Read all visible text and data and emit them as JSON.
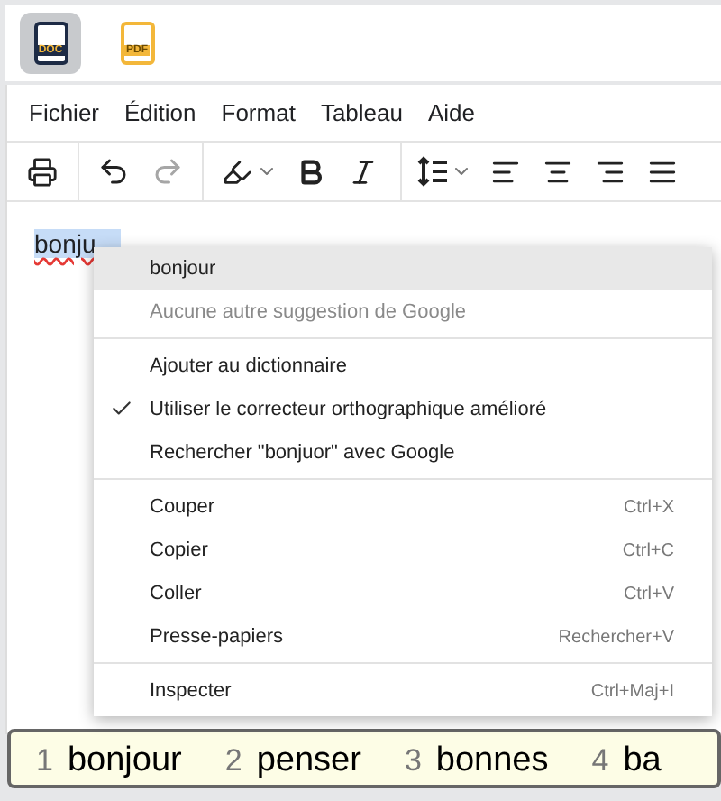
{
  "file_types": [
    {
      "label": "DOC",
      "selected": true
    },
    {
      "label": "PDF",
      "selected": false
    }
  ],
  "menu_bar": [
    "Fichier",
    "Édition",
    "Format",
    "Tableau",
    "Aide"
  ],
  "toolbar": {
    "redo_disabled": true
  },
  "document": {
    "text": "bonju"
  },
  "context_menu": {
    "sections": [
      [
        {
          "label": "bonjour",
          "selected": true,
          "disabled": false,
          "checked": false
        },
        {
          "label": "Aucune autre suggestion de Google",
          "selected": false,
          "disabled": true,
          "checked": false
        }
      ],
      [
        {
          "label": "Ajouter au dictionnaire",
          "selected": false,
          "disabled": false,
          "checked": false
        },
        {
          "label": "Utiliser le correcteur orthographique amélioré",
          "selected": false,
          "disabled": false,
          "checked": true
        },
        {
          "label": "Rechercher \"bonjuor\" avec Google",
          "selected": false,
          "disabled": false,
          "checked": false
        }
      ],
      [
        {
          "label": "Couper",
          "shortcut": "Ctrl+X",
          "selected": false,
          "disabled": false,
          "checked": false
        },
        {
          "label": "Copier",
          "shortcut": "Ctrl+C",
          "selected": false,
          "disabled": false,
          "checked": false
        },
        {
          "label": "Coller",
          "shortcut": "Ctrl+V",
          "selected": false,
          "disabled": false,
          "checked": false
        },
        {
          "label": "Presse-papiers",
          "shortcut": "Rechercher+V",
          "selected": false,
          "disabled": false,
          "checked": false
        }
      ],
      [
        {
          "label": "Inspecter",
          "shortcut": "Ctrl+Maj+I",
          "selected": false,
          "disabled": false,
          "checked": false
        }
      ]
    ]
  },
  "candidates": [
    {
      "number": "1",
      "word": "bonjour"
    },
    {
      "number": "2",
      "word": "penser"
    },
    {
      "number": "3",
      "word": "bonnes"
    },
    {
      "number": "4",
      "word": "ba"
    }
  ]
}
